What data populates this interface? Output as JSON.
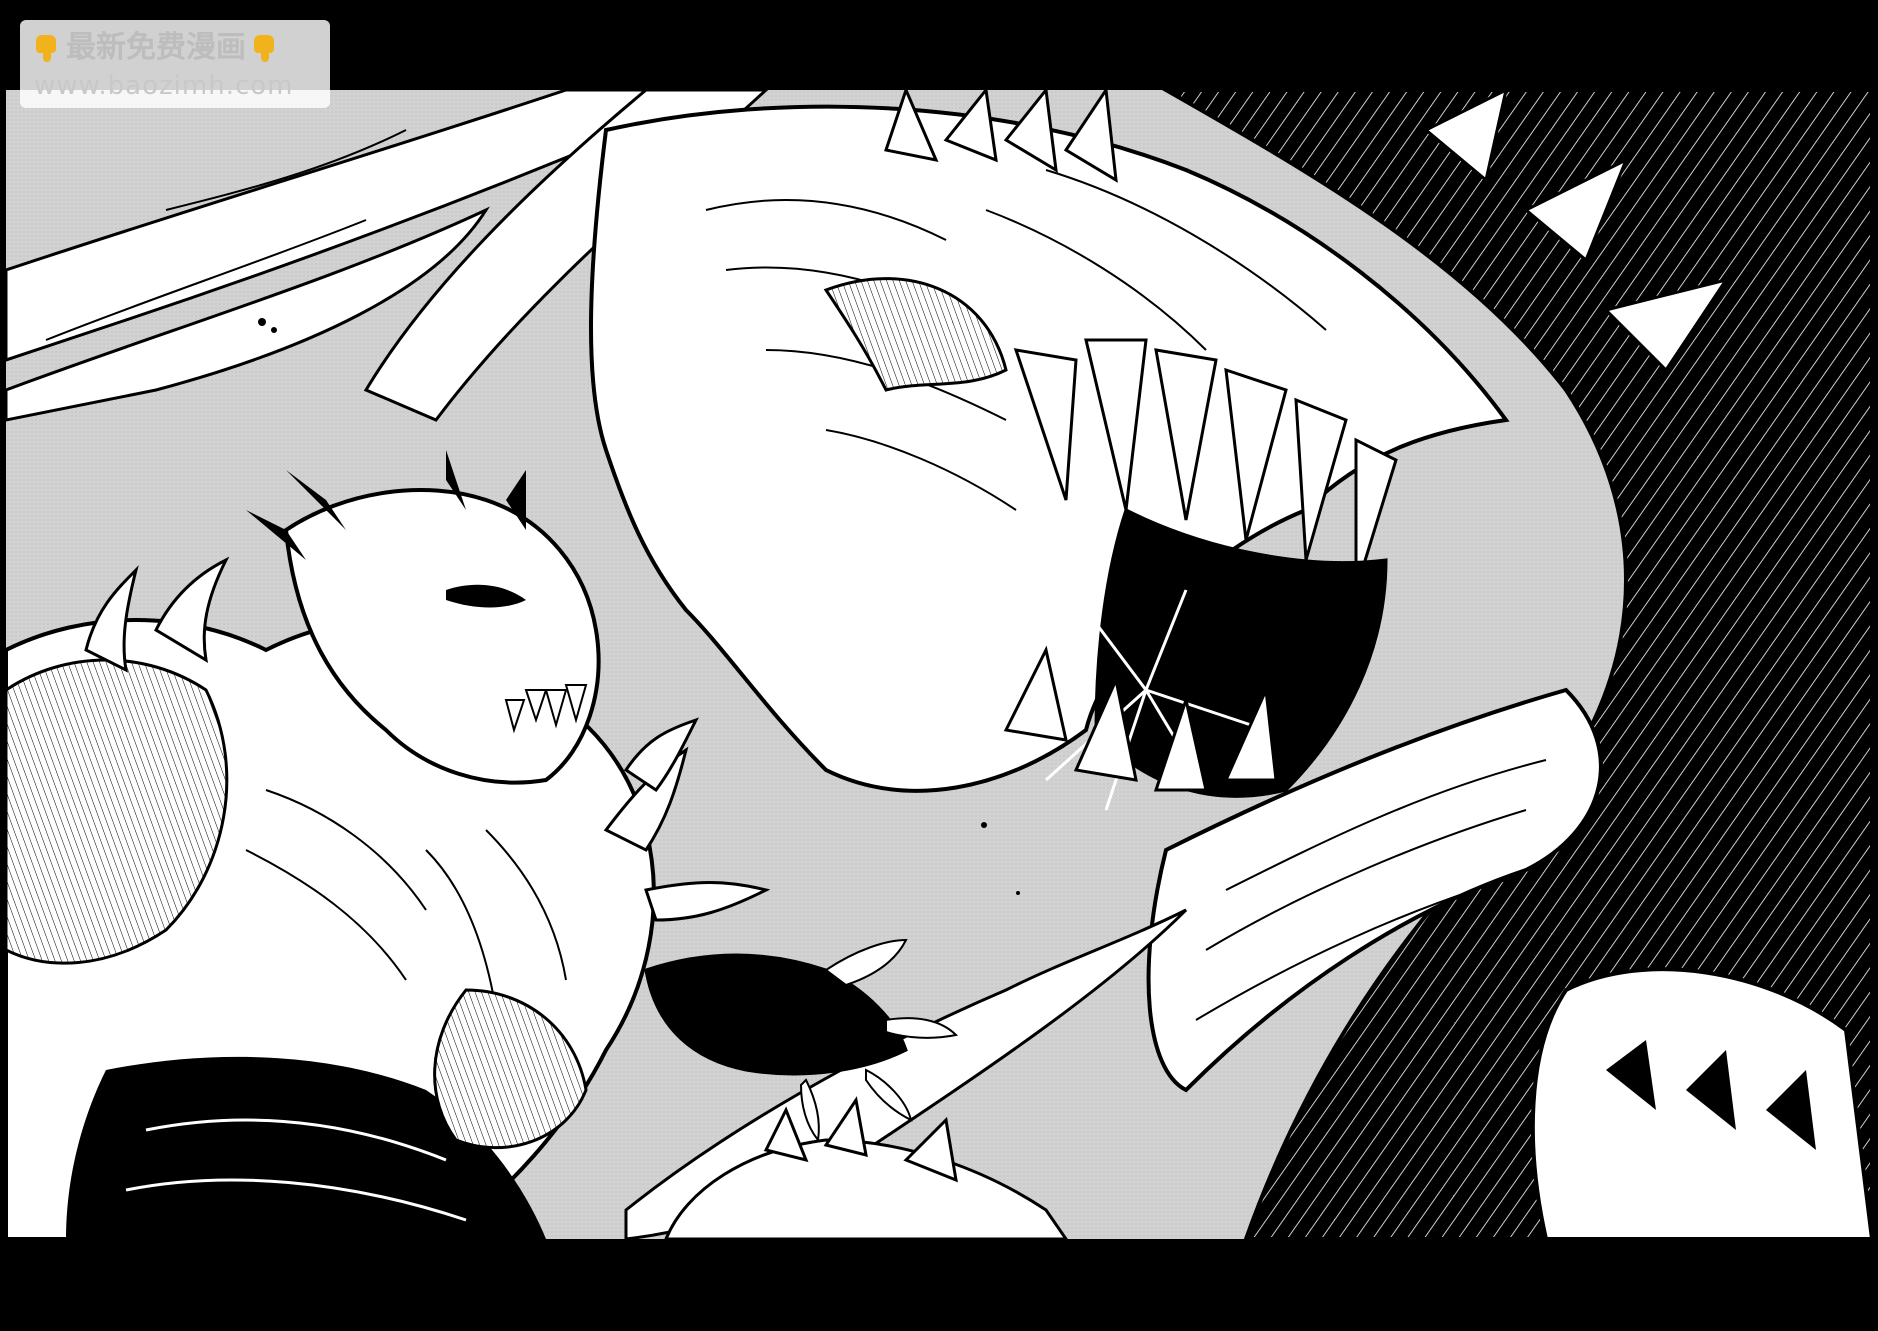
{
  "watermark": {
    "title": "最新免费漫画",
    "url": "www.baozimh.com",
    "left_icon": "pointing-down-hand-icon",
    "right_icon": "pointing-down-hand-icon"
  },
  "colors": {
    "letterbox": "#000000",
    "panel_tone": "#cfcfcf",
    "ink": "#000000",
    "paper": "#ffffff",
    "emoji_yellow": "#f2b21b"
  },
  "scene": {
    "subject_left": "armored-horned-beast",
    "subject_right": "fanged-dragon-maw"
  }
}
